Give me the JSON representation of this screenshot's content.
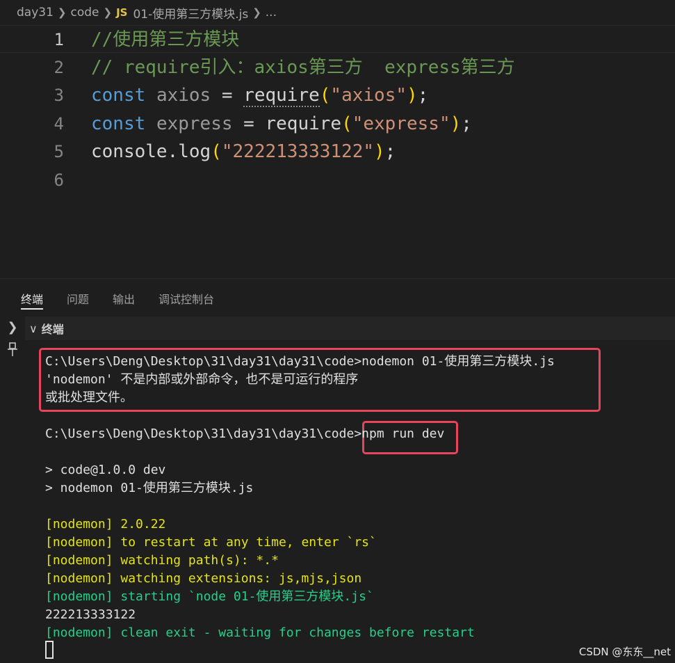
{
  "breadcrumb": {
    "parts": [
      "day31",
      "code"
    ],
    "file_icon": "JS",
    "file_name": "01-使用第三方模块.js",
    "trailing": "..."
  },
  "editor": {
    "lines": [
      {
        "num": "1",
        "tokens": [
          {
            "t": "//使用第三方模块",
            "c": "comment"
          }
        ]
      },
      {
        "num": "2",
        "tokens": [
          {
            "t": "// require引入：axios第三方  express第三方",
            "c": "comment"
          }
        ]
      },
      {
        "num": "3",
        "tokens": [
          {
            "t": "const",
            "c": "kw"
          },
          {
            "t": " ",
            "c": "plain"
          },
          {
            "t": "axios",
            "c": "dim"
          },
          {
            "t": " = ",
            "c": "op"
          },
          {
            "t": "require",
            "c": "plain",
            "squiggle": true
          },
          {
            "t": "(",
            "c": "paren"
          },
          {
            "t": "\"axios\"",
            "c": "str"
          },
          {
            "t": ")",
            "c": "paren"
          },
          {
            "t": ";",
            "c": "plain"
          }
        ]
      },
      {
        "num": "4",
        "tokens": [
          {
            "t": "const",
            "c": "kw"
          },
          {
            "t": " ",
            "c": "plain"
          },
          {
            "t": "express",
            "c": "dim"
          },
          {
            "t": " = ",
            "c": "op"
          },
          {
            "t": "require",
            "c": "plain"
          },
          {
            "t": "(",
            "c": "paren"
          },
          {
            "t": "\"express\"",
            "c": "str"
          },
          {
            "t": ")",
            "c": "paren"
          },
          {
            "t": ";",
            "c": "plain"
          }
        ]
      },
      {
        "num": "5",
        "tokens": [
          {
            "t": "console",
            "c": "plain"
          },
          {
            "t": ".",
            "c": "plain"
          },
          {
            "t": "log",
            "c": "plain"
          },
          {
            "t": "(",
            "c": "paren"
          },
          {
            "t": "\"222213333122\"",
            "c": "str"
          },
          {
            "t": ")",
            "c": "paren"
          },
          {
            "t": ";",
            "c": "plain"
          }
        ]
      },
      {
        "num": "6",
        "tokens": []
      }
    ]
  },
  "panel": {
    "tabs": [
      "终端",
      "问题",
      "输出",
      "调试控制台"
    ],
    "active_tab": "终端",
    "terminal_title": "终端"
  },
  "terminal": {
    "lines": [
      {
        "text": "C:\\Users\\Deng\\Desktop\\31\\day31\\day31\\code>nodemon 01-使用第三方模块.js",
        "color": "default"
      },
      {
        "text": "'nodemon' 不是内部或外部命令，也不是可运行的程序",
        "color": "default"
      },
      {
        "text": "或批处理文件。",
        "color": "default"
      },
      {
        "text": "",
        "color": "default"
      },
      {
        "text": "C:\\Users\\Deng\\Desktop\\31\\day31\\day31\\code>npm run dev",
        "color": "default"
      },
      {
        "text": "",
        "color": "default"
      },
      {
        "text": "> code@1.0.0 dev",
        "color": "default"
      },
      {
        "text": "> nodemon 01-使用第三方模块.js",
        "color": "default"
      },
      {
        "text": "",
        "color": "default"
      },
      {
        "text": "[nodemon] 2.0.22",
        "color": "yellow"
      },
      {
        "text": "[nodemon] to restart at any time, enter `rs`",
        "color": "yellow"
      },
      {
        "text": "[nodemon] watching path(s): *.*",
        "color": "yellow"
      },
      {
        "text": "[nodemon] watching extensions: js,mjs,json",
        "color": "yellow"
      },
      {
        "text": "[nodemon] starting `node 01-使用第三方模块.js`",
        "color": "green"
      },
      {
        "text": "222213333122",
        "color": "default"
      },
      {
        "text": "[nodemon] clean exit - waiting for changes before restart",
        "color": "green"
      }
    ]
  },
  "watermark": "CSDN @东东__net",
  "colors": {
    "highlight_box": "#e8455c",
    "terminal_yellow": "#e5e510",
    "terminal_green": "#23d18b"
  }
}
